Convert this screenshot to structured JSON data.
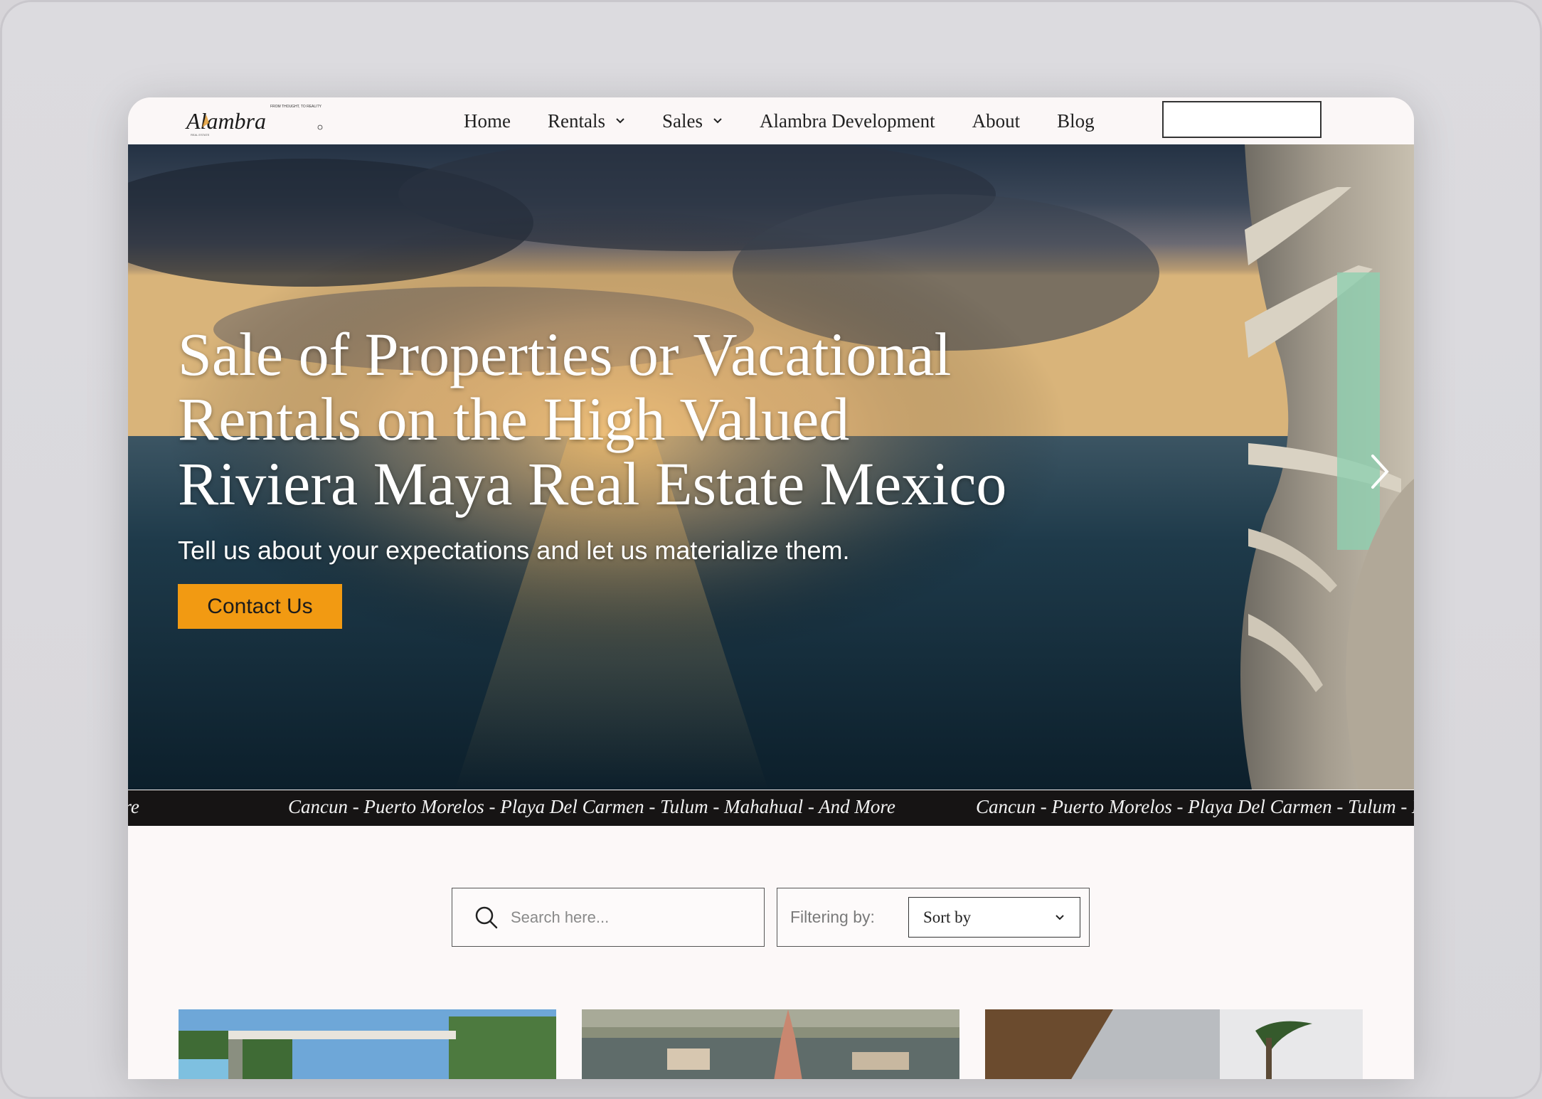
{
  "nav": {
    "items": [
      {
        "label": "Home",
        "dropdown": false
      },
      {
        "label": "Rentals",
        "dropdown": true
      },
      {
        "label": "Sales",
        "dropdown": true
      },
      {
        "label": "Alambra Development",
        "dropdown": false
      },
      {
        "label": "About",
        "dropdown": false
      },
      {
        "label": "Blog",
        "dropdown": false
      }
    ]
  },
  "logo": {
    "text": "Alambra",
    "tagline": "FROM THOUGHT, TO REALITY",
    "small": "REAL ESTATE"
  },
  "hero": {
    "title_lines": [
      "Sale of Properties or Vacational",
      "Rentals on the High Valued",
      "Riviera Maya Real Estate Mexico"
    ],
    "subtitle": "Tell us about your expectations and let us materialize them.",
    "cta_label": "Contact Us"
  },
  "ticker": {
    "text": "Cancun - Puerto Morelos - Playa Del Carmen - Tulum - Mahahual - And More"
  },
  "search": {
    "placeholder": "Search here...",
    "filter_label": "Filtering by:",
    "sort_value": "Sort by"
  },
  "colors": {
    "accent": "#f29a12",
    "ticker_bg": "#161414",
    "page_bg": "#fcf8f8"
  }
}
